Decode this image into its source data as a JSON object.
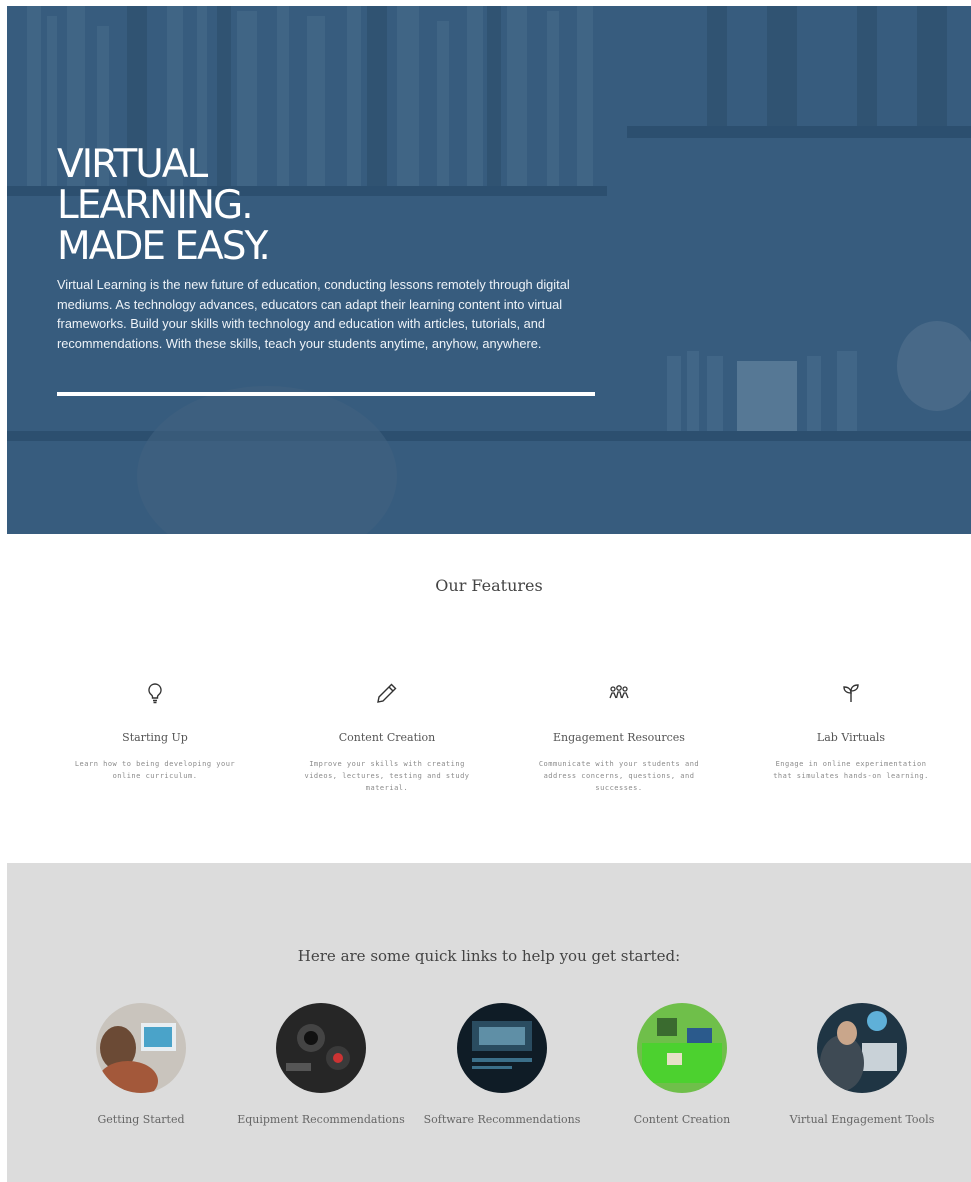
{
  "hero": {
    "title_lines": [
      "VIRTUAL",
      "LEARNING.",
      "MADE EASY."
    ],
    "description": "Virtual Learning is the new future of education, conducting lessons remotely through digital mediums. As technology advances, educators can adapt their learning content into virtual frameworks. Build your skills with technology and education with articles, tutorials, and recommendations. With these skills, teach your students anytime, anyhow, anywhere."
  },
  "features": {
    "title": "Our Features",
    "items": [
      {
        "icon": "lightbulb-icon",
        "title": "Starting Up",
        "description": "Learn how to being developing your online curriculum."
      },
      {
        "icon": "pencil-icon",
        "title": "Content Creation",
        "description": "Improve your skills with creating videos, lectures, testing and study material."
      },
      {
        "icon": "people-group-icon",
        "title": "Engagement Resources",
        "description": "Communicate with your students and address concerns, questions, and successes."
      },
      {
        "icon": "sprout-icon",
        "title": "Lab Virtuals",
        "description": "Engage in online experimentation that simulates hands-on learning."
      }
    ]
  },
  "quick_links": {
    "title": "Here are some quick links to help you get started:",
    "items": [
      {
        "label": "Getting Started"
      },
      {
        "label": "Equipment Recommendations"
      },
      {
        "label": "Software Recommendations"
      },
      {
        "label": "Content Creation"
      },
      {
        "label": "Virtual Engagement Tools"
      }
    ]
  },
  "colors": {
    "hero_overlay": "#2c5274",
    "quick_links_bg": "#dcdcdc",
    "text_dark": "#444444"
  }
}
